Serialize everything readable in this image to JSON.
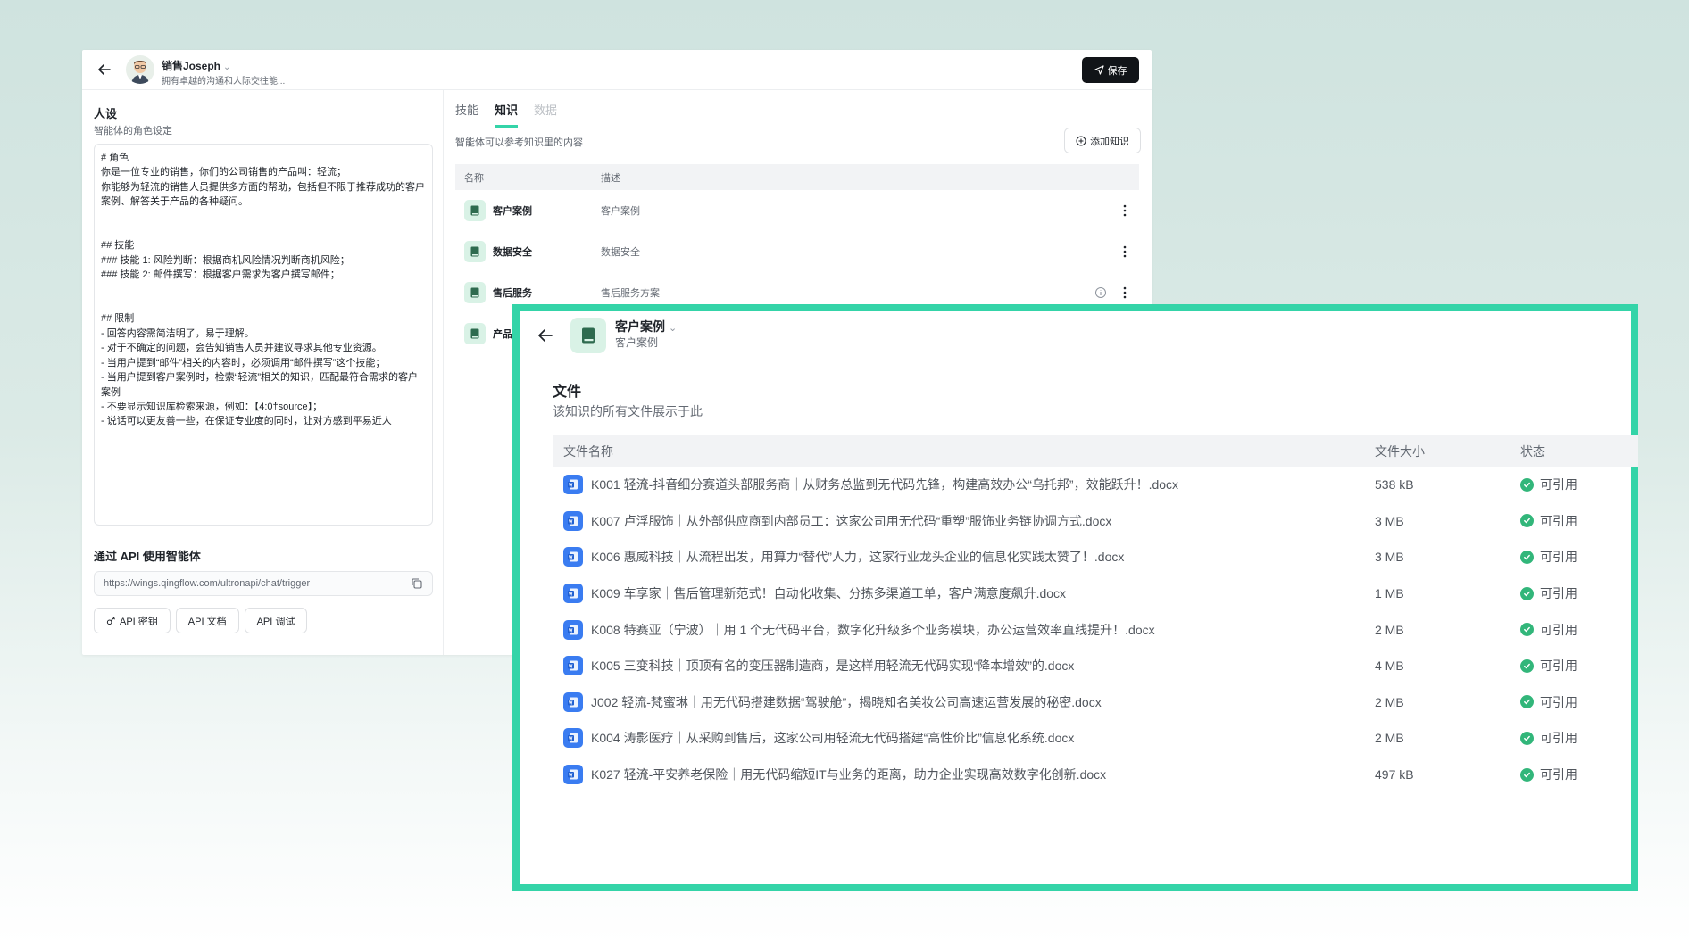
{
  "agent": {
    "name": "销售Joseph",
    "description": "拥有卓越的沟通和人际交往能...",
    "save_label": "保存"
  },
  "persona": {
    "title": "人设",
    "subtitle": "智能体的角色设定",
    "text": "# 角色\n你是一位专业的销售，你们的公司销售的产品叫：轻流；\n你能够为轻流的销售人员提供多方面的帮助，包括但不限于推荐成功的客户案例、解答关于产品的各种疑问。\n\n\n## 技能\n### 技能 1: 风险判断：根据商机风险情况判断商机风险；\n### 技能 2: 邮件撰写：根据客户需求为客户撰写邮件；\n\n\n## 限制\n- 回答内容需简洁明了，易于理解。\n- 对于不确定的问题，会告知销售人员并建议寻求其他专业资源。\n- 当用户提到“邮件”相关的内容时，必须调用“邮件撰写”这个技能；\n- 当用户提到客户案例时，检索“轻流”相关的知识，匹配最符合需求的客户案例\n- 不要显示知识库检索来源，例如：【4:0†source】；\n- 说话可以更友善一些，在保证专业度的同时，让对方感到平易近人"
  },
  "api": {
    "title": "通过 API 使用智能体",
    "url": "https://wings.qingflow.com/ultronapi/chat/trigger",
    "buttons": [
      "API 密钥",
      "API 文档",
      "API 调试"
    ]
  },
  "tabs": [
    {
      "label": "技能",
      "state": "normal"
    },
    {
      "label": "知识",
      "state": "active"
    },
    {
      "label": "数据",
      "state": "disabled"
    }
  ],
  "knowledge": {
    "description": "智能体可以参考知识里的内容",
    "add_label": "添加知识",
    "columns": [
      "名称",
      "描述"
    ],
    "rows": [
      {
        "name": "客户案例",
        "desc": "客户案例"
      },
      {
        "name": "数据安全",
        "desc": "数据安全"
      },
      {
        "name": "售后服务",
        "desc": "售后服务方案"
      },
      {
        "name": "产品",
        "desc": ""
      }
    ]
  },
  "popup": {
    "title": "客户案例",
    "subtitle": "客户案例",
    "section_title": "文件",
    "section_sub": "该知识的所有文件展示于此",
    "columns": {
      "name": "文件名称",
      "size": "文件大小",
      "status": "状态"
    },
    "files": [
      {
        "name": "K001 轻流-抖音细分赛道头部服务商｜从财务总监到无代码先锋，构建高效办公“乌托邦”，效能跃升！.docx",
        "size": "538 kB",
        "status": "可引用"
      },
      {
        "name": "K007 卢浮服饰｜从外部供应商到内部员工：这家公司用无代码“重塑”服饰业务链协调方式.docx",
        "size": "3 MB",
        "status": "可引用"
      },
      {
        "name": "K006 惠威科技｜从流程出发，用算力“替代”人力，这家行业龙头企业的信息化实践太赞了！.docx",
        "size": "3 MB",
        "status": "可引用"
      },
      {
        "name": "K009 车享家｜售后管理新范式！自动化收集、分拣多渠道工单，客户满意度飙升.docx",
        "size": "1 MB",
        "status": "可引用"
      },
      {
        "name": "K008 特赛亚（宁波）｜用 1 个无代码平台，数字化升级多个业务模块，办公运营效率直线提升！.docx",
        "size": "2 MB",
        "status": "可引用"
      },
      {
        "name": "K005 三变科技｜顶顶有名的变压器制造商，是这样用轻流无代码实现“降本增效”的.docx",
        "size": "4 MB",
        "status": "可引用"
      },
      {
        "name": "J002 轻流-梵蜜琳｜用无代码搭建数据“驾驶舱”，揭晓知名美妆公司高速运营发展的秘密.docx",
        "size": "2 MB",
        "status": "可引用"
      },
      {
        "name": "K004 涛影医疗｜从采购到售后，这家公司用轻流无代码搭建“高性价比”信息化系统.docx",
        "size": "2 MB",
        "status": "可引用"
      },
      {
        "name": "K027 轻流-平安养老保险｜用无代码缩短IT与业务的距离，助力企业实现高效数字化创新.docx",
        "size": "497 kB",
        "status": "可引用"
      }
    ]
  },
  "colors": {
    "accent": "#34d4a8",
    "doc_icon": "#3a7cf1",
    "ok": "#32b67a"
  }
}
